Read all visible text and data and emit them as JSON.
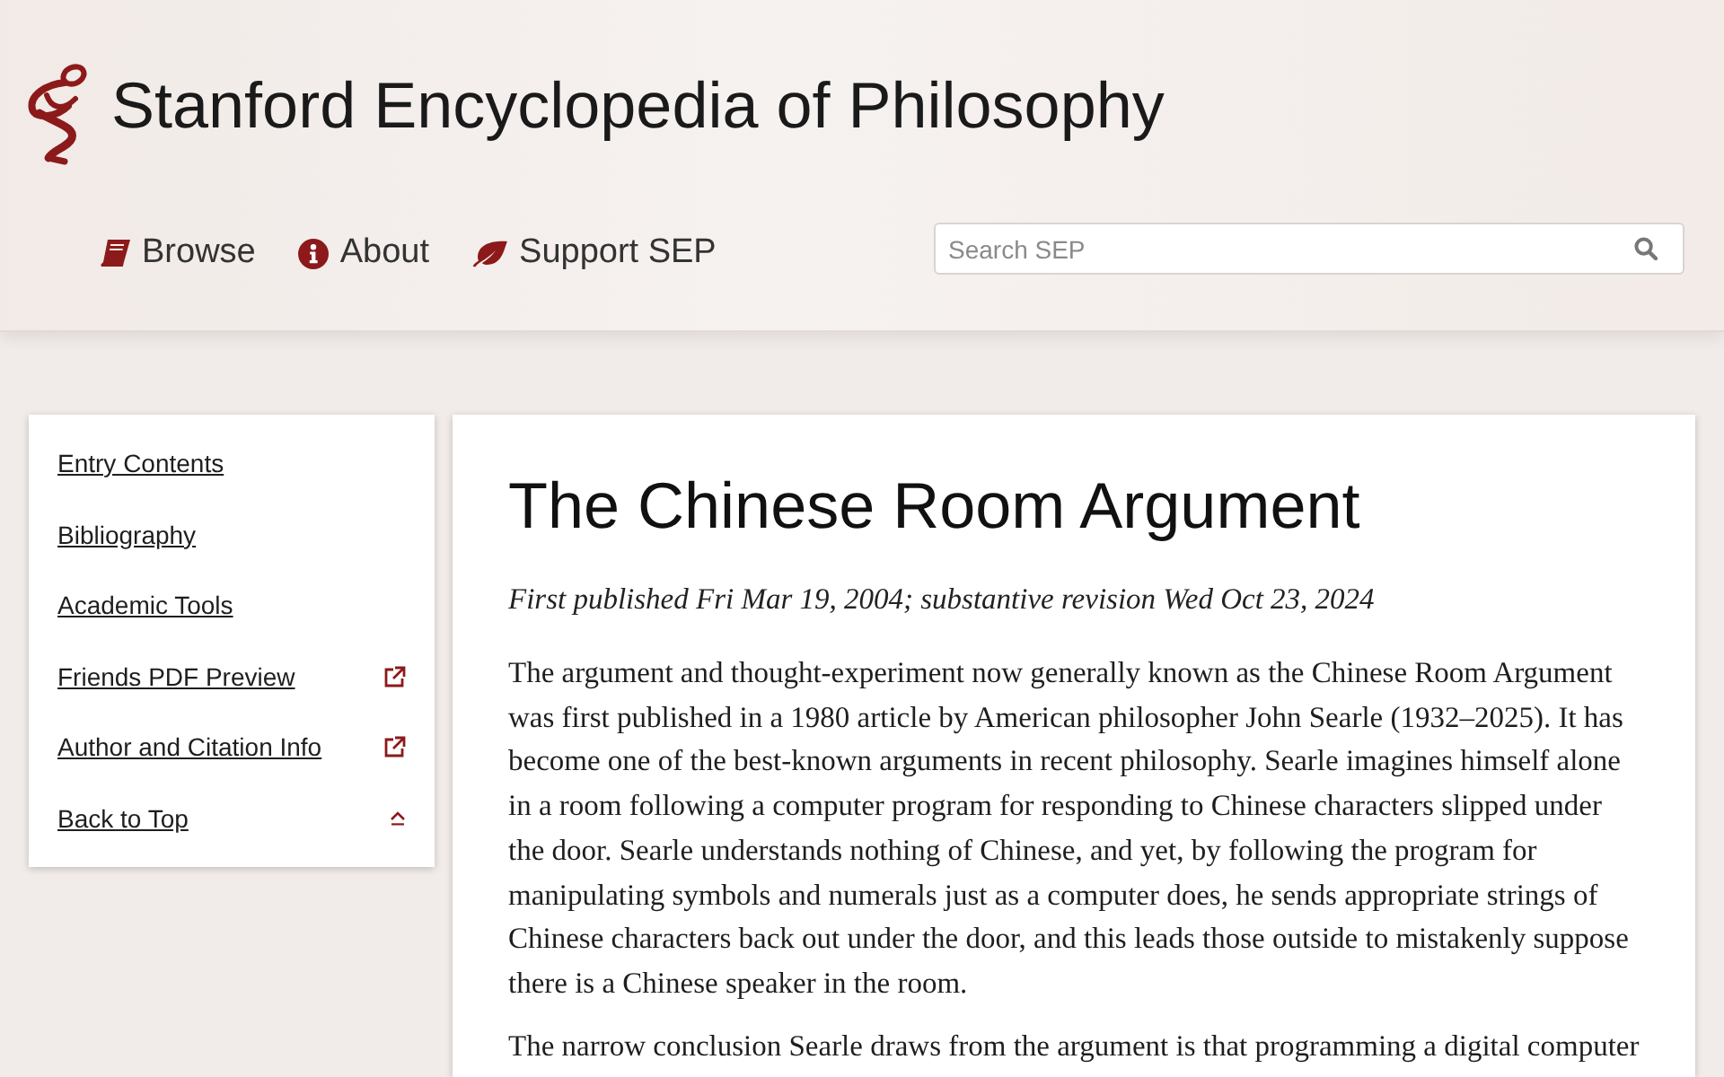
{
  "header": {
    "site_title": "Stanford Encyclopedia of Philosophy",
    "nav": [
      {
        "kind": "book",
        "label": "Browse"
      },
      {
        "kind": "info",
        "label": "About"
      },
      {
        "kind": "leaf",
        "label": "Support SEP"
      }
    ],
    "search": {
      "placeholder": "Search SEP"
    }
  },
  "sidebar": {
    "items": [
      {
        "kind": "plain",
        "label": "Entry Contents"
      },
      {
        "kind": "plain",
        "label": "Bibliography"
      },
      {
        "kind": "plain",
        "label": "Academic Tools"
      },
      {
        "kind": "external",
        "label": "Friends PDF Preview"
      },
      {
        "kind": "external",
        "label": "Author and Citation Info"
      },
      {
        "kind": "top",
        "label": "Back to Top"
      }
    ]
  },
  "article": {
    "title": "The Chinese Room Argument",
    "pubinfo": "First published Fri Mar 19, 2004; substantive revision Wed Oct 23, 2024",
    "paragraphs": [
      "The argument and thought-experiment now generally known as the Chinese Room Argument was first published in a 1980 article by American philosopher John Searle (1932–2025). It has become one of the best-known arguments in recent philosophy. Searle imagines himself alone in a room following a computer program for responding to Chinese characters slipped under the door. Searle understands nothing of Chinese, and yet, by following the program for manipulating symbols and numerals just as a computer does, he sends appropriate strings of Chinese characters back out under the door, and this leads those outside to mistakenly suppose there is a Chinese speaker in the room.",
      "The narrow conclusion Searle draws from the argument is that programming a digital computer"
    ]
  }
}
